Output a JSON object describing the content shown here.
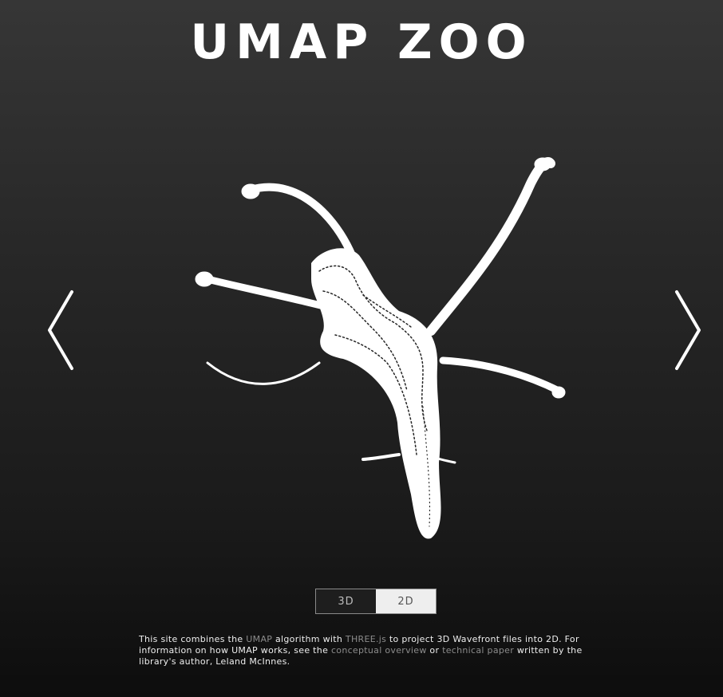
{
  "header": {
    "title": "UMAP ZOO"
  },
  "navigation": {
    "previous_icon": "chevron-left-icon",
    "next_icon": "chevron-right-icon"
  },
  "view_toggle": {
    "option_3d": "3D",
    "option_2d": "2D",
    "selected": "2D"
  },
  "about": {
    "part1": "This site combines the ",
    "link_umap": "UMAP",
    "part2": " algorithm with ",
    "link_three": "THREE.js",
    "part3": " to project 3D Wavefront files into 2D. For information on how UMAP works, see the ",
    "link_overview": "conceptual overview",
    "part4": " or ",
    "link_paper": "technical paper",
    "part5": " written by the library's author, Leland McInnes."
  },
  "colors": {
    "background_top": "#363636",
    "background_bottom": "#0d0d0d",
    "points": "#ffffff",
    "link": "#8c8c8c",
    "toggle_active": "#eeeeee"
  }
}
